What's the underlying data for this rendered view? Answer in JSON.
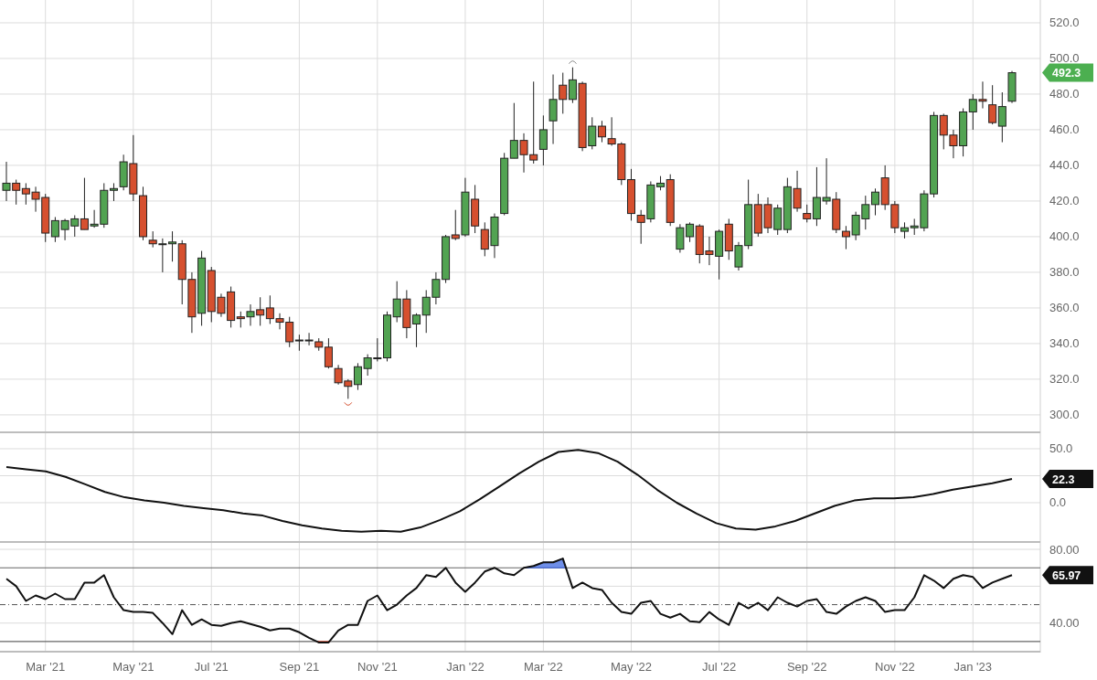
{
  "panels": [
    {
      "kind": "price",
      "last_tag": "492.3",
      "chart_data": {
        "type": "candlestick",
        "grid": true,
        "ylim": [
          289.7,
          532.8
        ],
        "yticks": [
          {
            "value": 300,
            "label": "300.0"
          },
          {
            "value": 320,
            "label": "320.0"
          },
          {
            "value": 340,
            "label": "340.0"
          },
          {
            "value": 360,
            "label": "360.0"
          },
          {
            "value": 380,
            "label": "380.0"
          },
          {
            "value": 400,
            "label": "400.0"
          },
          {
            "value": 420,
            "label": "420.0"
          },
          {
            "value": 440,
            "label": "440.0"
          },
          {
            "value": 460,
            "label": "460.0"
          },
          {
            "value": 480,
            "label": "480.0"
          },
          {
            "value": 500,
            "label": "500.0"
          },
          {
            "value": 520,
            "label": "520.0"
          }
        ],
        "ohlc": [
          [
            426,
            442,
            420,
            430
          ],
          [
            430,
            432,
            418,
            426
          ],
          [
            427,
            430,
            418,
            424
          ],
          [
            425,
            428,
            414,
            421
          ],
          [
            422,
            424,
            397,
            402
          ],
          [
            400,
            411,
            397,
            409
          ],
          [
            404,
            410,
            398,
            409
          ],
          [
            406,
            412,
            400,
            410
          ],
          [
            410,
            433,
            404,
            404
          ],
          [
            406,
            415,
            405,
            407
          ],
          [
            407,
            430,
            405,
            426
          ],
          [
            426,
            430,
            420,
            427
          ],
          [
            428,
            446,
            426,
            442
          ],
          [
            441,
            457,
            420,
            424
          ],
          [
            423,
            428,
            398,
            400
          ],
          [
            398,
            403,
            394,
            396
          ],
          [
            396,
            399,
            380,
            396
          ],
          [
            396,
            403,
            386,
            397
          ],
          [
            396,
            398,
            362,
            376
          ],
          [
            376,
            380,
            346,
            355
          ],
          [
            357,
            392,
            350,
            388
          ],
          [
            381,
            383,
            352,
            358
          ],
          [
            366,
            368,
            355,
            357
          ],
          [
            369,
            372,
            349,
            353
          ],
          [
            355,
            358,
            349,
            354
          ],
          [
            355,
            362,
            350,
            358
          ],
          [
            359,
            366,
            350,
            356
          ],
          [
            360,
            367,
            351,
            354
          ],
          [
            354,
            357,
            348,
            352
          ],
          [
            352,
            355,
            338,
            341
          ],
          [
            342,
            345,
            336,
            342
          ],
          [
            342,
            346,
            339,
            342
          ],
          [
            341,
            343,
            336,
            338
          ],
          [
            338,
            343,
            326,
            327
          ],
          [
            326,
            328,
            317,
            318
          ],
          [
            319,
            320,
            309,
            316
          ],
          [
            317,
            329,
            314,
            327
          ],
          [
            326,
            334,
            322,
            332
          ],
          [
            332,
            343,
            330,
            332
          ],
          [
            332,
            358,
            330,
            356
          ],
          [
            355,
            375,
            352,
            365
          ],
          [
            365,
            370,
            343,
            349
          ],
          [
            351,
            357,
            338,
            356
          ],
          [
            356,
            370,
            346,
            366
          ],
          [
            366,
            380,
            362,
            376
          ],
          [
            376,
            401,
            374,
            400
          ],
          [
            401,
            415,
            398,
            399
          ],
          [
            401,
            433,
            400,
            425
          ],
          [
            421,
            429,
            402,
            406
          ],
          [
            404,
            408,
            389,
            393
          ],
          [
            395,
            413,
            388,
            411
          ],
          [
            413,
            447,
            412,
            444
          ],
          [
            444,
            475,
            444,
            454
          ],
          [
            454,
            458,
            436,
            446
          ],
          [
            446,
            487,
            441,
            443
          ],
          [
            449,
            468,
            440,
            460
          ],
          [
            465,
            491,
            452,
            477
          ],
          [
            485,
            492,
            469,
            477
          ],
          [
            477,
            495,
            475,
            488
          ],
          [
            486,
            487,
            448,
            450
          ],
          [
            451,
            467,
            449,
            462
          ],
          [
            462,
            465,
            453,
            456
          ],
          [
            455,
            467,
            451,
            452
          ],
          [
            452,
            453,
            429,
            432
          ],
          [
            432,
            438,
            409,
            413
          ],
          [
            412,
            415,
            396,
            408
          ],
          [
            410,
            431,
            408,
            429
          ],
          [
            428,
            434,
            426,
            430
          ],
          [
            432,
            435,
            406,
            408
          ],
          [
            393,
            407,
            391,
            405
          ],
          [
            400,
            408,
            397,
            407
          ],
          [
            406,
            407,
            385,
            390
          ],
          [
            392,
            400,
            384,
            390
          ],
          [
            389,
            404,
            376,
            403
          ],
          [
            407,
            410,
            387,
            392
          ],
          [
            383,
            397,
            381,
            395
          ],
          [
            395,
            432,
            393,
            418
          ],
          [
            418,
            424,
            400,
            402
          ],
          [
            418,
            422,
            402,
            405
          ],
          [
            404,
            418,
            401,
            416
          ],
          [
            404,
            433,
            402,
            428
          ],
          [
            427,
            437,
            414,
            416
          ],
          [
            413,
            418,
            408,
            410
          ],
          [
            410,
            439,
            406,
            422
          ],
          [
            420,
            444,
            418,
            422
          ],
          [
            421,
            425,
            402,
            404
          ],
          [
            403,
            406,
            393,
            400
          ],
          [
            401,
            414,
            398,
            412
          ],
          [
            410,
            423,
            404,
            418
          ],
          [
            418,
            427,
            412,
            425
          ],
          [
            433,
            440,
            415,
            418
          ],
          [
            418,
            420,
            402,
            405
          ],
          [
            403,
            408,
            399,
            405
          ],
          [
            405,
            410,
            401,
            406
          ],
          [
            405,
            426,
            403,
            424
          ],
          [
            424,
            470,
            422,
            468
          ],
          [
            468,
            469,
            449,
            457
          ],
          [
            457,
            460,
            444,
            451
          ],
          [
            451,
            472,
            445,
            470
          ],
          [
            470,
            480,
            460,
            477
          ],
          [
            477,
            487,
            472,
            476
          ],
          [
            474,
            485,
            463,
            464
          ],
          [
            462,
            481,
            453,
            473
          ],
          [
            476,
            493,
            475,
            492
          ]
        ]
      }
    },
    {
      "kind": "oscillator",
      "last_tag": "22.3",
      "chart_data": {
        "type": "line",
        "grid": true,
        "ylim": [
          -37.3,
          64.4
        ],
        "yticks": [
          {
            "value": 0,
            "label": "0.0"
          },
          {
            "value": 50,
            "label": "50.0"
          }
        ],
        "series": [
          {
            "values": [
              33,
              31,
              29,
              24,
              17,
              10,
              5,
              2,
              0,
              -3,
              -5,
              -7,
              -10,
              -12,
              -17,
              -21,
              -24,
              -26,
              -27,
              -26,
              -27,
              -23,
              -16,
              -8,
              3,
              15,
              27,
              38,
              47,
              49,
              46,
              38,
              26,
              12,
              0,
              -10,
              -19,
              -24,
              -25,
              -22,
              -17,
              -10,
              -3,
              2,
              4,
              4,
              5,
              8,
              12,
              15,
              18,
              22
            ]
          }
        ]
      }
    },
    {
      "kind": "rsi",
      "last_tag": "65.97",
      "chart_data": {
        "type": "line",
        "grid": true,
        "ylim": [
          24,
          83.5
        ],
        "yticks": [
          {
            "value": 40,
            "label": "40.00"
          },
          {
            "value": 80,
            "label": "80.00"
          }
        ],
        "ref_lines": [
          {
            "axis": "y",
            "value": 70
          },
          {
            "axis": "y",
            "value": 50
          },
          {
            "axis": "y",
            "value": 30
          }
        ],
        "categories": [
          null,
          null,
          null,
          null,
          "Mar '21",
          null,
          null,
          null,
          null,
          null,
          null,
          null,
          null,
          "May '21",
          null,
          null,
          null,
          null,
          null,
          null,
          null,
          "Jul '21",
          null,
          null,
          null,
          null,
          null,
          null,
          null,
          null,
          "Sep '21",
          null,
          null,
          null,
          null,
          null,
          null,
          null,
          "Nov '21",
          null,
          null,
          null,
          null,
          null,
          null,
          null,
          null,
          "Jan '22",
          null,
          null,
          null,
          null,
          null,
          null,
          null,
          "Mar '22",
          null,
          null,
          null,
          null,
          null,
          null,
          null,
          null,
          "May '22",
          null,
          null,
          null,
          null,
          null,
          null,
          null,
          null,
          "Jul '22",
          null,
          null,
          null,
          null,
          null,
          null,
          null,
          null,
          "Sep '22",
          null,
          null,
          null,
          null,
          null,
          null,
          null,
          null,
          "Nov '22",
          null,
          null,
          null,
          null,
          null,
          null,
          null,
          "Jan '23",
          null,
          null,
          null,
          null
        ],
        "series": [
          {
            "values": [
              64,
              60,
              52,
              55,
              53,
              56,
              53,
              53,
              62,
              62,
              66,
              54,
              47,
              46,
              46,
              45.5,
              40,
              34,
              47,
              39,
              42,
              39,
              38.5,
              40,
              41,
              39.5,
              38,
              36,
              37,
              37,
              35,
              32,
              29.5,
              29.5,
              36,
              39,
              39,
              52,
              55,
              47,
              50,
              55,
              59,
              66,
              65,
              70,
              62,
              57,
              62,
              68,
              70,
              67,
              66,
              70,
              71,
              73,
              73,
              75,
              59,
              62,
              59,
              58,
              51,
              46,
              45,
              51,
              52,
              45,
              43,
              45,
              41,
              40.5,
              46,
              42,
              39,
              51,
              48,
              51,
              47,
              54,
              51,
              49,
              52,
              53,
              46,
              45,
              49,
              52,
              54,
              52,
              46,
              47,
              47,
              54,
              66,
              63,
              59,
              64,
              66,
              65,
              59,
              62,
              64,
              66
            ]
          }
        ]
      }
    }
  ]
}
